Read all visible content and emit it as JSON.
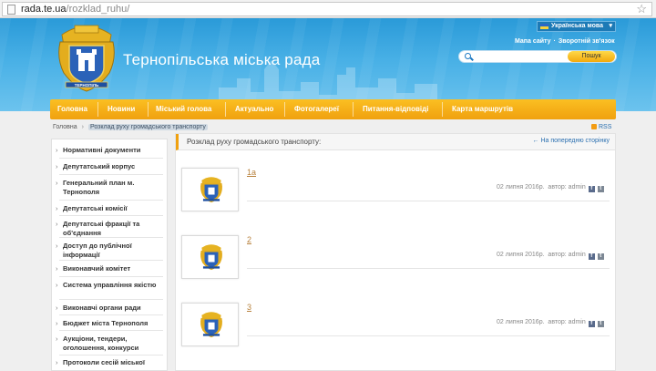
{
  "browser": {
    "url_host": "rada.te.ua",
    "url_path": "/rozklad_ruhu/"
  },
  "header": {
    "site_title": "Тернопільська міська рада",
    "language": "Українська мова",
    "top_links": [
      "Мапа сайту",
      "Зворотній зв'язок"
    ],
    "search_button": "Пошук",
    "search_placeholder": ""
  },
  "nav": {
    "items": [
      "Головна",
      "Новини",
      "Міський голова",
      "Актуально",
      "Фотогалереї",
      "Питання-відповіді",
      "Карта маршрутів"
    ]
  },
  "breadcrumb": {
    "home": "Головна",
    "current": "Розклад руху громадського транспорту"
  },
  "rss": "RSS",
  "sidebar": {
    "items": [
      "Нормативні документи",
      "Депутатський корпус",
      "Генеральний план м. Тернополя",
      "Депутатські комісії",
      "Депутатські фракції та об'єднання",
      "Доступ до публічної інформації",
      "Виконавчий комітет",
      "Система управління якістю",
      "Виконавчі органи ради",
      "Бюджет міста Тернополя",
      "Аукціони, тендери, оголошення, конкурси",
      "Протоколи сесій міської"
    ]
  },
  "main": {
    "heading": "Розклад руху громадського транспорту:",
    "back_link": "← На попередню сторінку",
    "items": [
      {
        "title": "1а",
        "date": "02 липня 2016р.",
        "author": "автор: admin"
      },
      {
        "title": "2",
        "date": "02 липня 2016р.",
        "author": "автор: admin"
      },
      {
        "title": "3",
        "date": "02 липня 2016р.",
        "author": "автор: admin"
      }
    ]
  },
  "colors": {
    "header_blue": "#2a9ad8",
    "nav_orange": "#f0a10f",
    "link_blue": "#2a6fb0",
    "item_title": "#b8823e"
  },
  "icons": {
    "logo": "ternopil-coat-of-arms-icon",
    "search": "search-icon",
    "star": "bookmark-star-icon",
    "rss": "rss-icon",
    "facebook": "facebook-icon",
    "twitter": "twitter-icon"
  }
}
